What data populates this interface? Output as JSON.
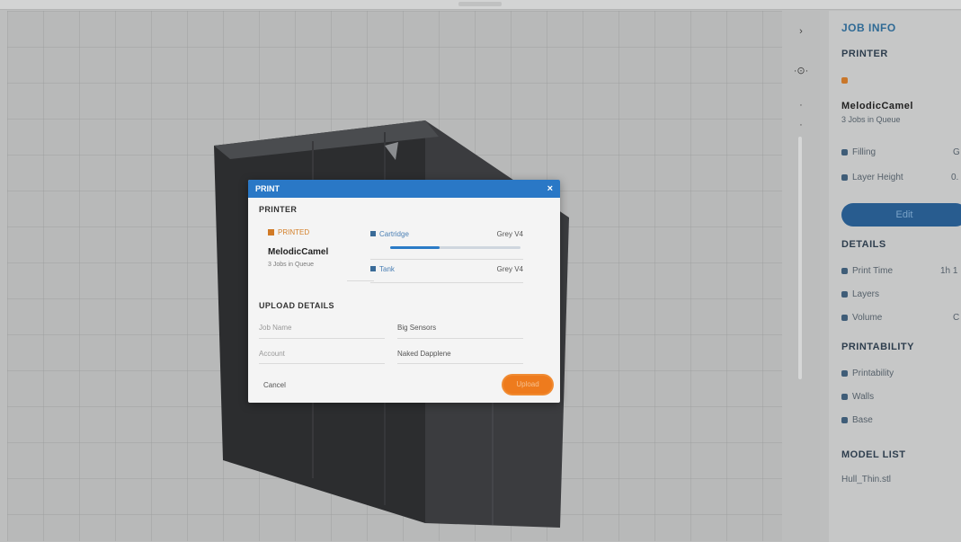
{
  "colors": {
    "accent": "#2a78c6",
    "upload": "#ee7b1d",
    "panel": "#c6c7c7"
  },
  "side_panel": {
    "title": "JOB INFO",
    "printer_heading": "PRINTER",
    "printer_tag": "",
    "printer_name": "MelodicCamel",
    "printer_sub": "3 Jobs in Queue",
    "fields": [
      {
        "label": "Filling",
        "value": "G"
      },
      {
        "label": "Layer Height",
        "value": "0."
      }
    ],
    "edit_label": "Edit",
    "details_heading": "DETAILS",
    "details": [
      {
        "label": "Print Time",
        "value": "1h 1"
      },
      {
        "label": "Layers",
        "value": ""
      },
      {
        "label": "Volume",
        "value": "C"
      }
    ],
    "printability_heading": "PRINTABILITY",
    "printability": [
      "Printability",
      "Walls",
      "Base"
    ],
    "model_list_heading": "MODEL LIST",
    "model_list_item": "Hull_Thin.stl"
  },
  "dialog": {
    "title": "PRINT",
    "close_glyph": "×",
    "printer_heading": "PRINTER",
    "printer_tag": "PRINTED",
    "printer_name": "MelodicCamel",
    "printer_sub": "3 Jobs in Queue",
    "materials": [
      {
        "name": "Cartridge",
        "value": "Grey V4",
        "progress": 0.38
      },
      {
        "name": "Tank",
        "value": "Grey V4"
      }
    ],
    "upload_heading": "UPLOAD DETAILS",
    "job_name_label": "Job Name",
    "job_name_value": "Big Sensors",
    "account_label": "Account",
    "account_value": "Naked Dapplene",
    "cancel_label": "Cancel",
    "upload_label": "Upload"
  }
}
